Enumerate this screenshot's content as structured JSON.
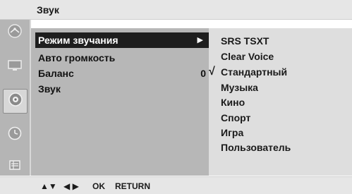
{
  "header": {
    "title": "Звук"
  },
  "sidebar": {
    "icons": [
      {
        "name": "satellite-dish-icon",
        "selected": false
      },
      {
        "name": "monitor-icon",
        "selected": false
      },
      {
        "name": "speaker-icon",
        "selected": true
      },
      {
        "name": "clock-icon",
        "selected": false
      },
      {
        "name": "toolbox-icon",
        "selected": false
      }
    ]
  },
  "menu": {
    "items": [
      {
        "label": "Режим звучания",
        "value": "",
        "selected": true,
        "arrow": "▶"
      },
      {
        "label": "Авто громкость",
        "value": ""
      },
      {
        "label": "Баланс",
        "value": "0"
      },
      {
        "label": "Звук",
        "value": ""
      }
    ]
  },
  "submenu": {
    "check_mark": "√",
    "checked_option": "Стандартный",
    "options": [
      {
        "label": "SRS TSXT"
      },
      {
        "label": "Clear Voice"
      },
      {
        "label": "Стандартный",
        "checked": true
      },
      {
        "label": "Музыка"
      },
      {
        "label": "Кино"
      },
      {
        "label": "Спорт"
      },
      {
        "label": "Игра"
      },
      {
        "label": "Пользователь"
      }
    ]
  },
  "footer": {
    "up_down": "▲▼",
    "left_right": "◀ ▶",
    "ok_label": "OK",
    "return_label": "RETURN"
  },
  "colors": {
    "selected_bg": "#1e1e1e",
    "selected_text": "#ffffff",
    "left_panel": "#b7b7b7",
    "right_panel": "#dedede",
    "icon_bar": "#b5b5b5",
    "header_bg": "#e6e6e6"
  }
}
